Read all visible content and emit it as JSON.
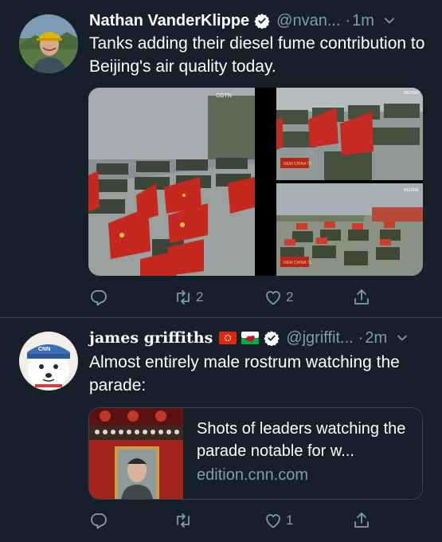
{
  "tweets": [
    {
      "author_name": "Nathan VanderKlippe",
      "handle": "@nvan...",
      "separator": "·",
      "time": "1m",
      "text": "Tanks adding their diesel fume contribution to Beijing's air quality today.",
      "media_labels": {
        "left_logo": "CGTN",
        "tr_logo": "BEIJING",
        "br_logo": "BEIJING",
        "new_china_badge": "NEW CHINA 70"
      },
      "actions": {
        "reply": "",
        "retweet": "2",
        "like": "2",
        "share": ""
      }
    },
    {
      "author_name": "james griffiths",
      "handle": "@jgriffit...",
      "separator": "·",
      "time": "2m",
      "text": "Almost entirely male rostrum watching the parade:",
      "card": {
        "title": "Shots of leaders watching the parade notable for w...",
        "domain": "edition.cnn.com"
      },
      "actions": {
        "reply": "",
        "retweet": "",
        "like": "1",
        "share": ""
      }
    }
  ],
  "colors": {
    "background": "#15202b",
    "text_primary": "#ffffff",
    "text_secondary": "#8899a6",
    "verified": "#ffffff",
    "divider": "#38444d"
  },
  "icons": [
    "verified-icon",
    "chevron-down-icon",
    "reply-icon",
    "retweet-icon",
    "like-icon",
    "share-icon",
    "hong-kong-flag-icon",
    "wales-flag-icon"
  ]
}
